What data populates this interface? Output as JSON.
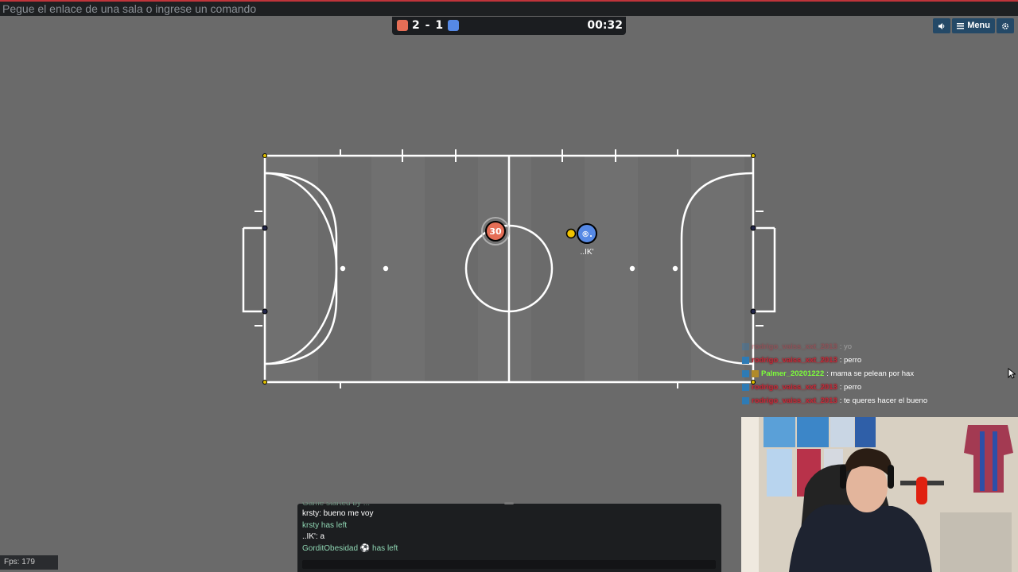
{
  "command_bar": {
    "placeholder": "Pegue el enlace de una sala o ingrese un comando"
  },
  "scoreboard": {
    "red_score": "2",
    "separator": "-",
    "blue_score": "1",
    "timer": "00:32"
  },
  "top_buttons": {
    "sound_icon": "speaker-icon",
    "menu_label": "Menu",
    "settings_icon": "gear-icon"
  },
  "players": {
    "red_avatar": "30",
    "blue_avatar": "®.",
    "blue_name": "..IK'"
  },
  "colors": {
    "red_team": "#e56e56",
    "blue_team": "#5689e5",
    "ball": "#f2c400",
    "pitch": "#707070"
  },
  "ingame_chat": [
    {
      "nick": "rodrigo_vaiss_xxt_2013",
      "text": ": yo",
      "nick_color": "red",
      "faded": true
    },
    {
      "nick": "rodrigo_vaiss_xxt_2013",
      "text": ": perro",
      "nick_color": "red",
      "faded": false
    },
    {
      "nick": "Palmer_20201222",
      "text": ": mama se pelean por hax",
      "nick_color": "green",
      "faded": false
    },
    {
      "nick": "rodrigo_vaiss_xxt_2013",
      "text": ": perro",
      "nick_color": "red",
      "faded": false
    },
    {
      "nick": "rodrigo_vaiss_xxt_2013",
      "text": ": te queres hacer el bueno",
      "nick_color": "red",
      "faded": false
    }
  ],
  "chat_log": {
    "clipped_line": "Game started by ...",
    "lines": [
      {
        "text": "krsty: bueno me voy",
        "type": "message"
      },
      {
        "text": "krsty has left",
        "type": "notice"
      },
      {
        "text": "..IK': a",
        "type": "message"
      },
      {
        "text": "GorditObesidad ⚽ has left",
        "type": "notice"
      }
    ]
  },
  "fps": {
    "label": "Fps: 179"
  }
}
